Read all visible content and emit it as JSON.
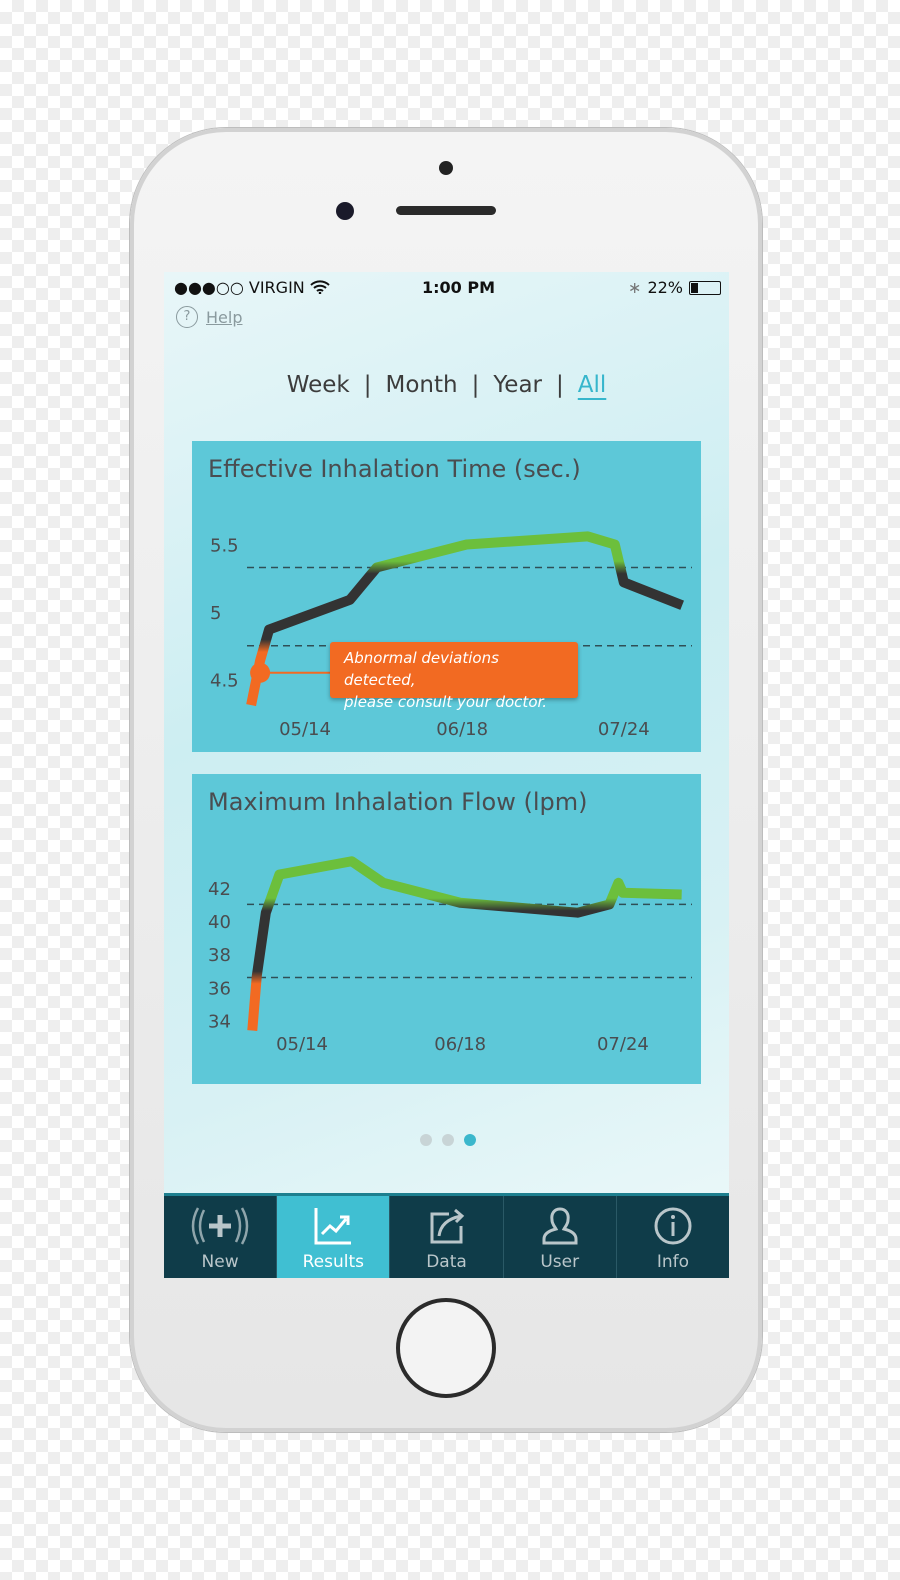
{
  "status_bar": {
    "carrier": "●●●○○ VIRGIN",
    "time": "1:00 PM",
    "battery": "22%",
    "battery_level": 0.22
  },
  "help": {
    "icon": "question-circle-icon",
    "label": "Help"
  },
  "range_tabs": {
    "items": [
      "Week",
      "Month",
      "Year",
      "All"
    ],
    "selected": "All",
    "separator": "|",
    "accent": "#36b6cc"
  },
  "chart_data": [
    {
      "type": "line",
      "title": "Effective Inhalation Time (sec.)",
      "yticks": [
        "5.5",
        "5",
        "4.5"
      ],
      "xticks": [
        "05/14",
        "06/18",
        "07/24"
      ],
      "thresholds": [
        5.33,
        4.75
      ],
      "x": [
        "05/02",
        "05/04",
        "05/06",
        "05/24",
        "05/30",
        "06/19",
        "07/16",
        "07/22",
        "07/24",
        "08/06"
      ],
      "values": [
        4.31,
        4.64,
        4.87,
        5.09,
        5.33,
        5.5,
        5.56,
        5.5,
        5.22,
        5.05
      ],
      "colors": {
        "above": "#6cbf3c",
        "normal": "#333333",
        "below": "#f26a22",
        "panel": "#5dc8d8"
      },
      "annotation": {
        "x": "05/04",
        "value": 4.55,
        "text_line1": "Abnormal deviations detected,",
        "text_line2": "please consult your doctor."
      }
    },
    {
      "type": "line",
      "title": "Maximum Inhalation Flow (lpm)",
      "yticks": [
        "42",
        "40",
        "38",
        "36",
        "34"
      ],
      "xticks": [
        "05/14",
        "06/18",
        "07/24"
      ],
      "thresholds": [
        41.0,
        36.6
      ],
      "x": [
        "05/03",
        "05/04",
        "05/06",
        "05/09",
        "05/25",
        "06/01",
        "06/18",
        "07/14",
        "07/21",
        "07/23",
        "07/24",
        "08/06"
      ],
      "values": [
        33.4,
        36.7,
        40.5,
        42.8,
        43.6,
        42.3,
        41.1,
        40.5,
        41.0,
        42.3,
        41.7,
        41.6
      ],
      "colors": {
        "above": "#6cbf3c",
        "normal": "#333333",
        "below": "#f26a22",
        "panel": "#5dc8d8"
      }
    }
  ],
  "pagination": {
    "pages": 3,
    "current": 3
  },
  "bottom_nav": {
    "items": [
      {
        "label": "New",
        "icon": "plus-waves-icon"
      },
      {
        "label": "Results",
        "icon": "chart-trend-icon"
      },
      {
        "label": "Data",
        "icon": "share-export-icon"
      },
      {
        "label": "User",
        "icon": "user-icon"
      },
      {
        "label": "Info",
        "icon": "info-icon"
      }
    ],
    "selected": "Results"
  }
}
